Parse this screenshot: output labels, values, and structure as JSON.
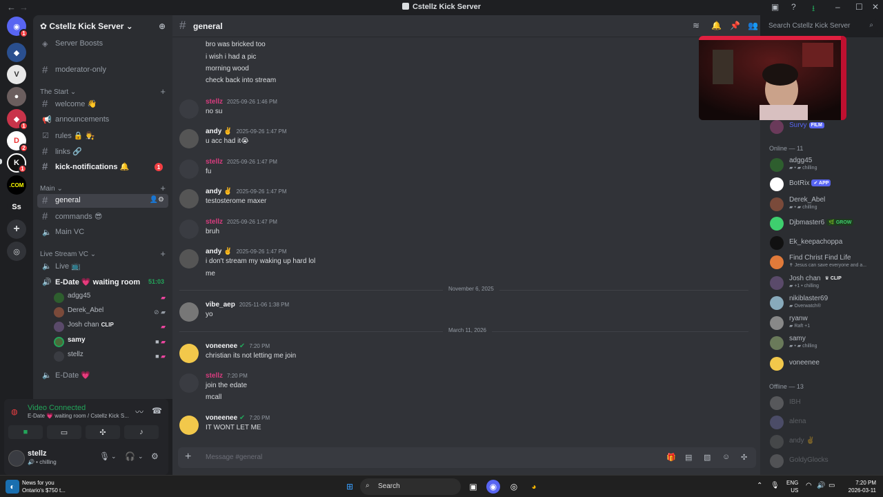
{
  "window": {
    "title": "Cstellz Kick Server"
  },
  "server": {
    "name": "Cstellz Kick Server",
    "boosts_label": "Server Boosts",
    "channels_top": [
      {
        "name": "moderator-only"
      }
    ],
    "categories": [
      {
        "name": "The Start",
        "channels": [
          "welcome 👋",
          "announcements",
          "rules 🔒 👨‍⚖️",
          "links 🔗",
          "kick-notifications 🔔"
        ]
      },
      {
        "name": "Main",
        "channels": [
          "general",
          "commands 😎",
          "Main VC"
        ]
      },
      {
        "name": "Live Stream VC",
        "channels": [
          "Live 📺",
          "E-Date 💗 waiting room",
          "E-Date 💗"
        ]
      }
    ],
    "kick_badge": "1",
    "vc_timer": "51:03",
    "vc_users": [
      {
        "name": "adgg45",
        "tag": ""
      },
      {
        "name": "Derek_Abel",
        "tag": ""
      },
      {
        "name": "Josh chan",
        "tag": "CLIP"
      },
      {
        "name": "samy",
        "tag": ""
      },
      {
        "name": "stellz",
        "tag": ""
      }
    ]
  },
  "voice_panel": {
    "status": "Video Connected",
    "location": "E-Date 💗 waiting room / Cstellz Kick S..."
  },
  "user_panel": {
    "name": "stellz",
    "status": "chilling"
  },
  "chat": {
    "channel": "general",
    "search_placeholder": "Search Cstellz Kick Server",
    "composer_placeholder": "Message #general",
    "top_lines": [
      "bro was bricked too",
      "i wish i had a pic",
      "morning wood",
      "check back into stream"
    ],
    "messages": [
      {
        "author": "stellz",
        "time": "2025-09-26 1:46 PM",
        "lines": [
          "no su"
        ]
      },
      {
        "author": "andy ✌️",
        "time": "2025-09-26 1:47 PM",
        "lines": [
          "u acc had it😭"
        ]
      },
      {
        "author": "stellz",
        "time": "2025-09-26 1:47 PM",
        "lines": [
          "fu"
        ]
      },
      {
        "author": "andy ✌️",
        "time": "2025-09-26 1:47 PM",
        "lines": [
          "testosterome maxer"
        ]
      },
      {
        "author": "stellz",
        "time": "2025-09-26 1:47 PM",
        "lines": [
          "bruh"
        ]
      },
      {
        "author": "andy ✌️",
        "time": "2025-09-26 1:47 PM",
        "lines": [
          "i don't stream my waking up hard lol",
          "me"
        ]
      },
      {
        "author": "vibe_aep",
        "time": "2025-11-06 1:38 PM",
        "lines": [
          "yo"
        ]
      },
      {
        "author": "voneenee",
        "time": "7:20 PM",
        "lines": [
          "christian its not letting me join"
        ]
      },
      {
        "author": "stellz",
        "time": "7:20 PM",
        "lines": [
          "join the edate",
          "mcall"
        ]
      },
      {
        "author": "voneenee",
        "time": "7:20 PM",
        "lines": [
          "IT WONT LET ME"
        ]
      }
    ],
    "dividers": [
      "November 6, 2025",
      "March 11, 2026"
    ]
  },
  "members": {
    "top_member": {
      "name": "Survy",
      "tag": "FILM"
    },
    "online_header": "Online — 11",
    "online": [
      {
        "name": "adgg45",
        "status": "chilling",
        "tag": ""
      },
      {
        "name": "BotRix",
        "status": "",
        "tag": "APP"
      },
      {
        "name": "Derek_Abel",
        "status": "chilling",
        "tag": ""
      },
      {
        "name": "Djbmaster6",
        "status": "",
        "tag": "GROW"
      },
      {
        "name": "Ek_keepachoppa",
        "status": "",
        "tag": ""
      },
      {
        "name": "Find Christ Find Life",
        "status": "Jesus can save everyone and a...",
        "tag": ""
      },
      {
        "name": "Josh chan",
        "status": "+1 • chilling",
        "tag": "CLIP"
      },
      {
        "name": "nikiblaster69",
        "status": "Overwatch®",
        "tag": ""
      },
      {
        "name": "ryanw",
        "status": "Raft +1",
        "tag": ""
      },
      {
        "name": "samy",
        "status": "chilling",
        "tag": ""
      },
      {
        "name": "voneenee",
        "status": "",
        "tag": ""
      }
    ],
    "offline_header": "Offline — 13",
    "offline": [
      {
        "name": "IBH"
      },
      {
        "name": "alena"
      },
      {
        "name": "andy ✌️"
      },
      {
        "name": "GoldyGlocks"
      }
    ]
  },
  "taskbar": {
    "news_title": "News for you",
    "news_sub": "Ontario's $750 t...",
    "search": "Search",
    "lang": "ENG",
    "region": "US",
    "time": "7:20 PM",
    "date": "2026-03-11"
  },
  "colors": {
    "accent": "#5865f2",
    "online": "#23a55a",
    "danger": "#f23f43",
    "stellz": "#d83c7e"
  }
}
